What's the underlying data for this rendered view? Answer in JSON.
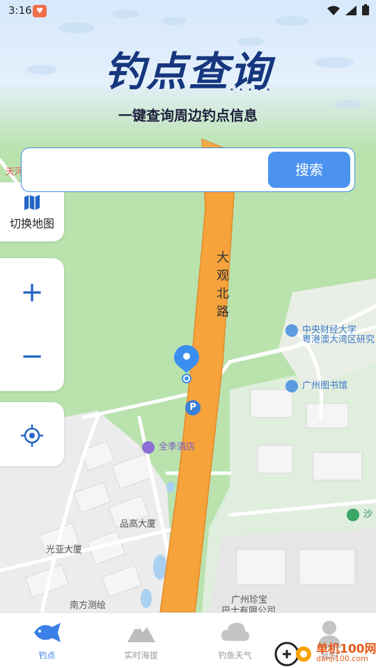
{
  "status_bar": {
    "time": "3:16"
  },
  "header": {
    "title": "钓点查询",
    "subtitle": "一键查询周边钓点信息"
  },
  "search": {
    "placeholder": "",
    "button_label": "搜索"
  },
  "map_controls": {
    "switch_map_label": "切换地图",
    "zoom_in": "+",
    "zoom_out": "−"
  },
  "map_labels": {
    "road": "大观北路",
    "tianhe": "天河",
    "cufe": "中央财经大学",
    "gba": "粤港澳大湾区研究",
    "library": "广州图书馆",
    "hotel": "全季酒店",
    "pingao": "品高大厦",
    "guangya": "光亚大厦",
    "nanfang": "南方测绘",
    "zhenbao1": "广州珍宝",
    "zhenbao2": "巴士有限公司",
    "sha": "沙",
    "parking": "P"
  },
  "bottom_nav": {
    "items": [
      {
        "label": "钓点",
        "active": true,
        "icon": "fish-icon"
      },
      {
        "label": "实时海拔",
        "active": false,
        "icon": "mountain-icon"
      },
      {
        "label": "钓鱼天气",
        "active": false,
        "icon": "cloud-icon"
      },
      {
        "label": "我的",
        "active": false,
        "icon": "user-icon"
      }
    ]
  },
  "watermark": {
    "text": "单机100网",
    "url": "danji100.com"
  },
  "colors": {
    "accent": "#4b93ef",
    "title": "#16367e",
    "road": "#f6a33c",
    "map_green": "#b9e2ad"
  }
}
